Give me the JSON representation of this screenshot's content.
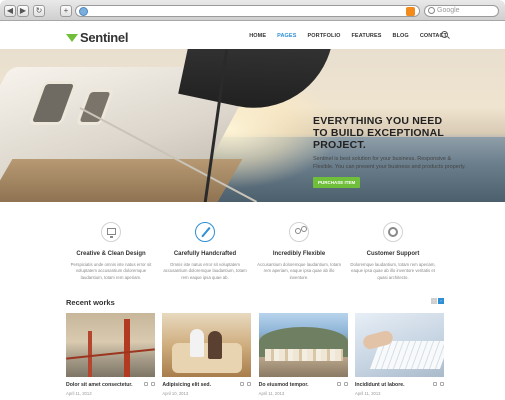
{
  "browser": {
    "search_placeholder": "Google",
    "back_icon": "back-arrow-icon",
    "forward_icon": "forward-arrow-icon",
    "reload_icon": "reload-icon",
    "add_icon": "plus-icon"
  },
  "site": {
    "logo": "Sentinel",
    "menu": [
      {
        "label": "HOME"
      },
      {
        "label": "PAGES",
        "active": true
      },
      {
        "label": "PORTFOLIO"
      },
      {
        "label": "FEATURES"
      },
      {
        "label": "BLOG"
      },
      {
        "label": "CONTACT"
      }
    ]
  },
  "hero": {
    "heading_line1": "EVERYTHING YOU NEED",
    "heading_line2": "TO BUILD EXCEPTIONAL PROJECT.",
    "body": "Sentinel is best solution for your business. Responsive & Flexible. You can present your business and products properly.",
    "button": "PURCHASE ITEM"
  },
  "features": [
    {
      "title": "Creative & Clean Design",
      "text": "Perspiciatis unde omnis iste natus error sit voluptatem accusantium doloremque laudantium, totam rem aperiam.",
      "icon": "monitor-icon"
    },
    {
      "title": "Carefully Handcrafted",
      "text": "Omnis iste natus error sit voluptatem accusantium doloremque laudantium, totam rem eaque ipsa quae ab.",
      "icon": "magic-wand-icon"
    },
    {
      "title": "Incredibly Flexible",
      "text": "Accusantium doloremque laudantium, totam rem aperiam, eaque ipsa quae ab illo inventore.",
      "icon": "gears-icon"
    },
    {
      "title": "Customer Support",
      "text": "Doloremque laudantium, totam rem aperiam, eaque ipsa quae ab illo inventore veritatis et quasi architecto.",
      "icon": "lifebuoy-icon"
    }
  ],
  "recent": {
    "title": "Recent works",
    "pager_prev": "‹",
    "pager_next": "›",
    "items": [
      {
        "title": "Dolor sit amet consectetur.",
        "date": "April 11, 2013"
      },
      {
        "title": "Adipisicing elit sed.",
        "date": "April 10, 2013"
      },
      {
        "title": "Do eiusmod tempor.",
        "date": "April 11, 2013"
      },
      {
        "title": "Incididunt ut labore.",
        "date": "April 11, 2013"
      }
    ]
  },
  "colors": {
    "accent_green": "#6fbf3b",
    "accent_blue": "#2e8fd5"
  }
}
